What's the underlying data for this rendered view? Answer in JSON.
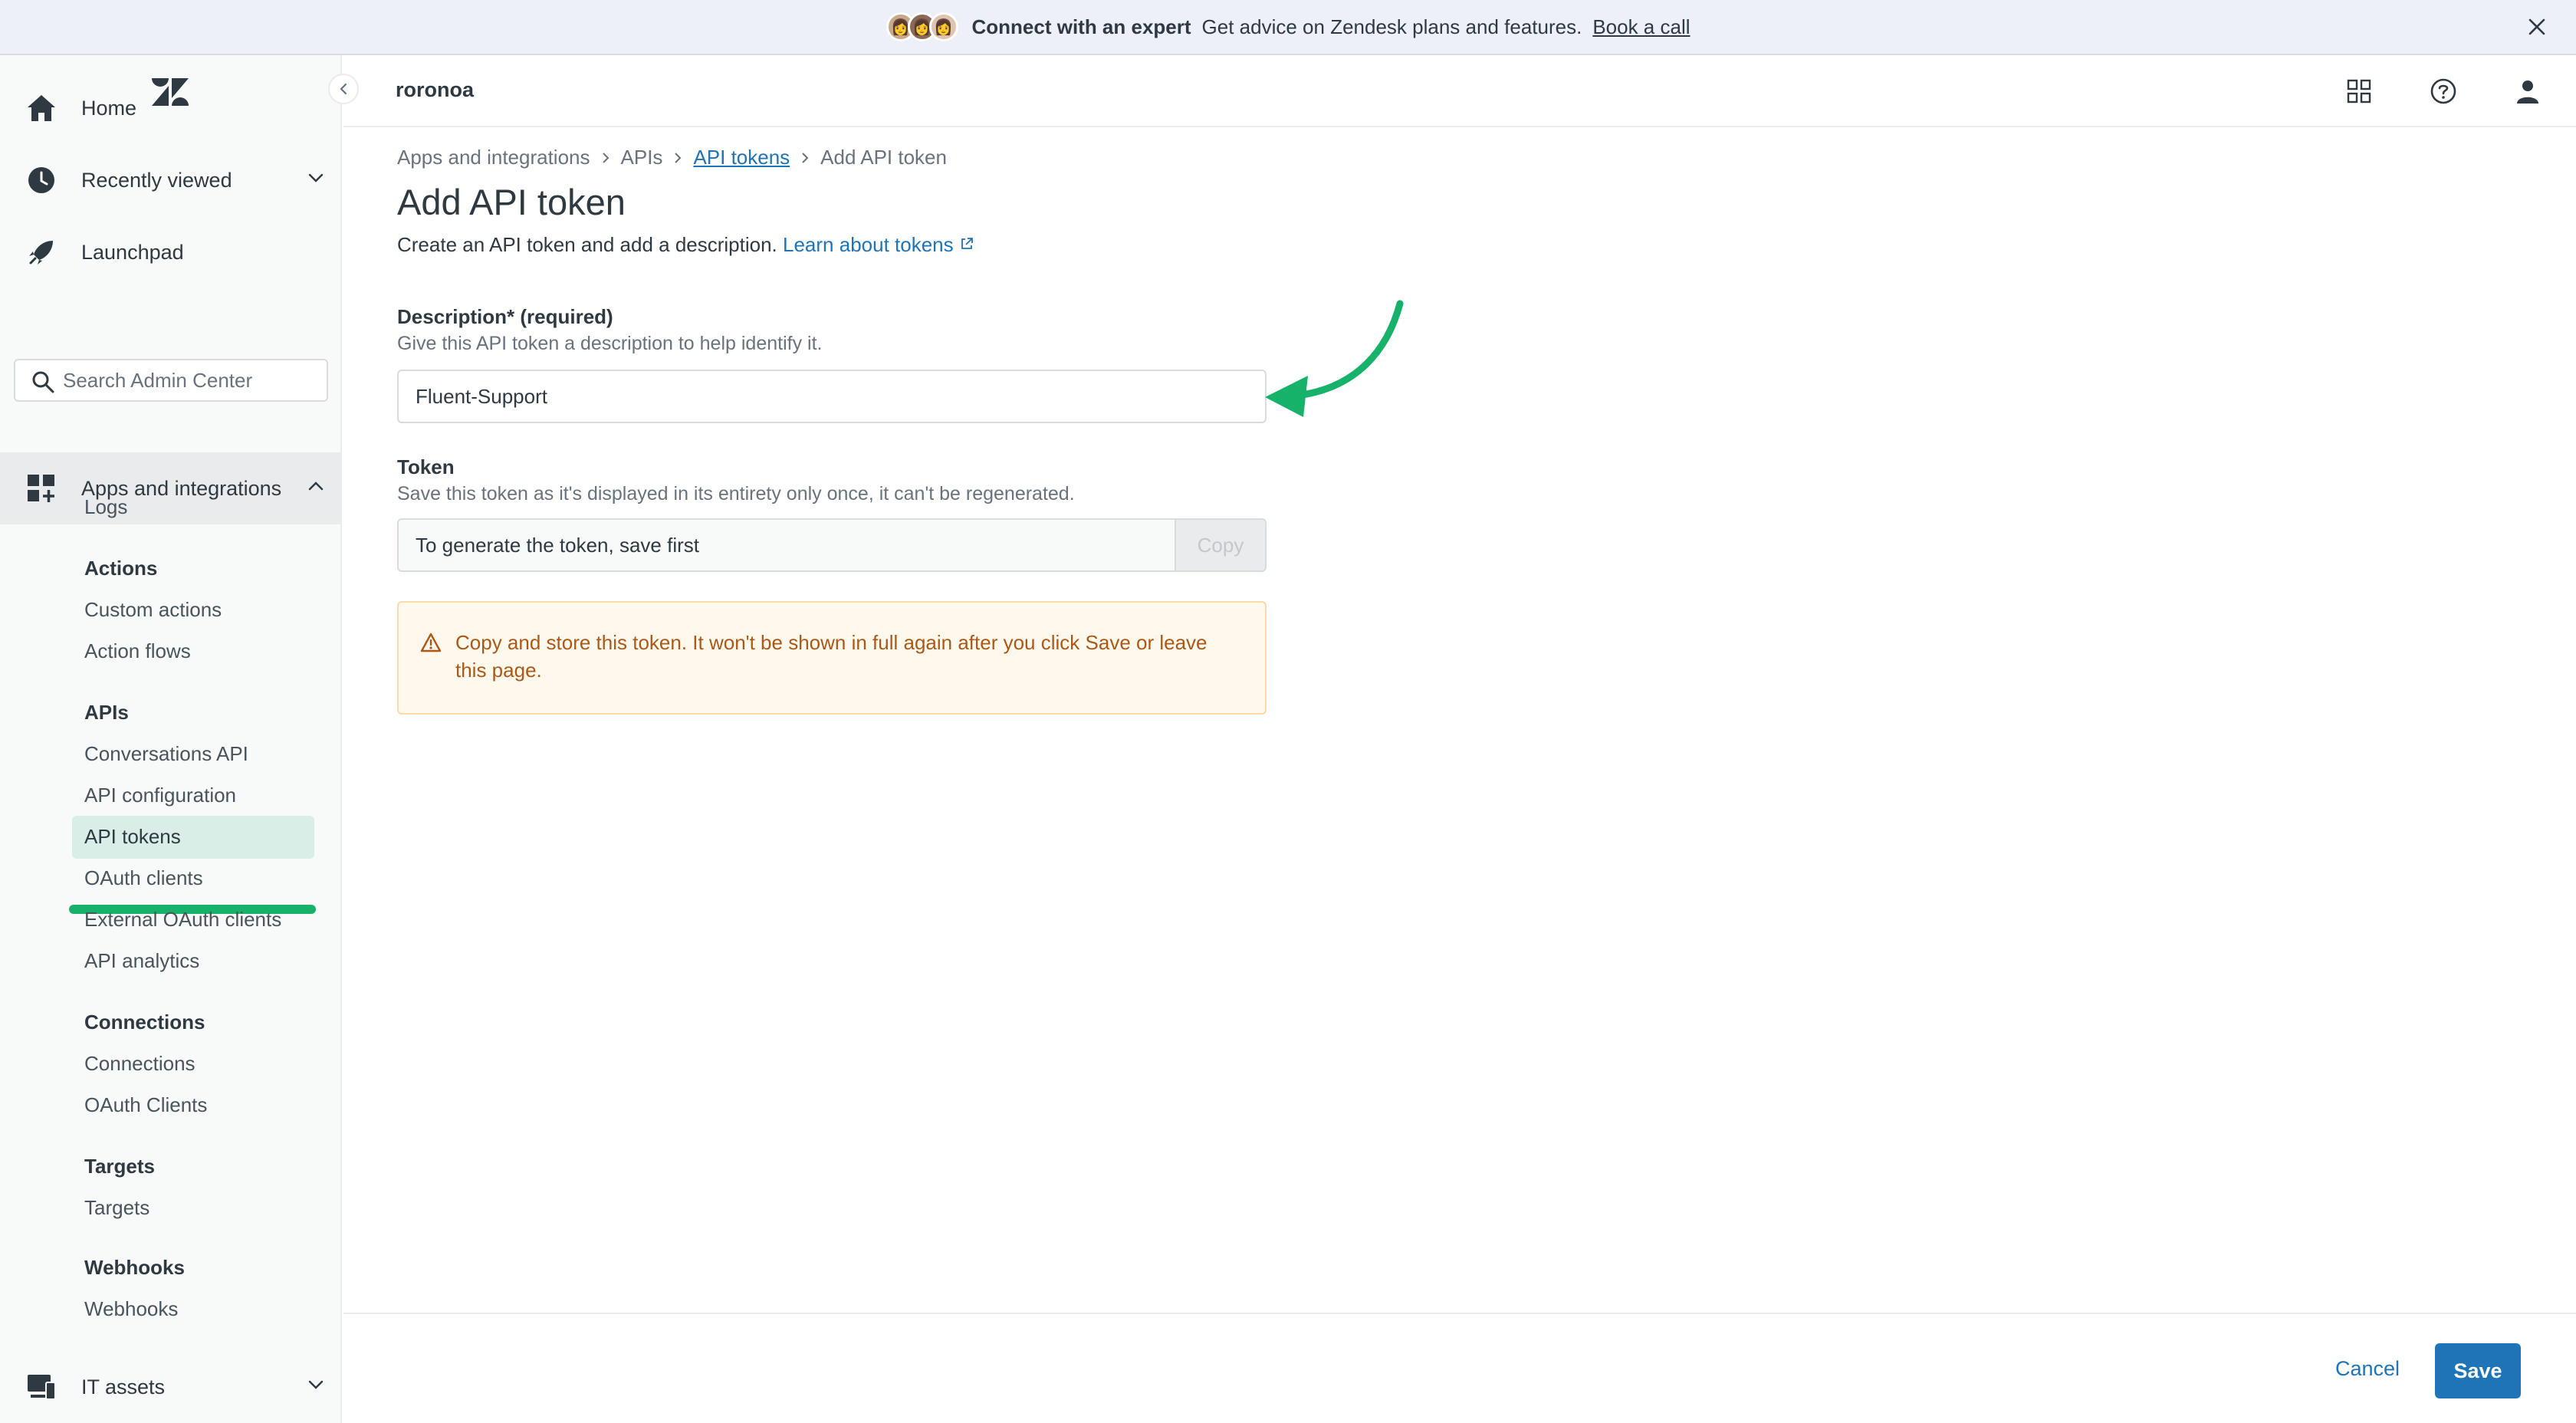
{
  "banner": {
    "heading": "Connect with an expert",
    "text": "Get advice on Zendesk plans and features.",
    "link": "Book a call"
  },
  "account": {
    "name": "roronoa"
  },
  "sidebar": {
    "home": "Home",
    "recently_viewed": "Recently viewed",
    "launchpad": "Launchpad",
    "search_placeholder": "Search Admin Center",
    "apps_integrations": "Apps and integrations",
    "logs": "Logs",
    "actions_header": "Actions",
    "custom_actions": "Custom actions",
    "action_flows": "Action flows",
    "apis_header": "APIs",
    "conversations_api": "Conversations API",
    "api_configuration": "API configuration",
    "api_tokens": "API tokens",
    "oauth_clients": "OAuth clients",
    "external_oauth_clients": "External OAuth clients",
    "api_analytics": "API analytics",
    "connections_header": "Connections",
    "connections": "Connections",
    "oauth_clients_2": "OAuth Clients",
    "targets_header": "Targets",
    "targets": "Targets",
    "webhooks_header": "Webhooks",
    "webhooks": "Webhooks",
    "it_assets": "IT assets"
  },
  "breadcrumb": [
    "Apps and integrations",
    "APIs",
    "API tokens",
    "Add API token"
  ],
  "page": {
    "title": "Add API token",
    "lead": "Create an API token and add a description.",
    "learn_link": "Learn about tokens",
    "description_label": "Description* (required)",
    "description_hint": "Give this API token a description to help identify it.",
    "description_value": "Fluent-Support",
    "token_label": "Token",
    "token_hint": "Save this token as it's displayed in its entirety only once, it can't be regenerated.",
    "token_placeholder": "To generate the token, save first",
    "copy_label": "Copy",
    "warning": "Copy and store this token. It won't be shown in full again after you click Save or leave this page."
  },
  "footer": {
    "cancel": "Cancel",
    "save": "Save"
  },
  "colors": {
    "accent": "#1f73b7",
    "annotation": "#17b26a",
    "warning_text": "#ac5918"
  }
}
